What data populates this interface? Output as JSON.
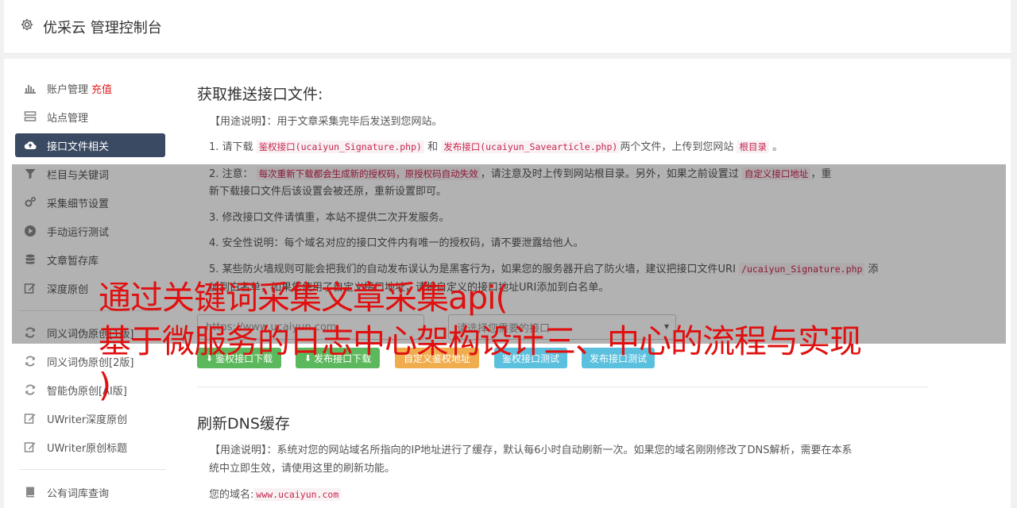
{
  "header": {
    "title": "优采云 管理控制台"
  },
  "sidebar": {
    "items": [
      {
        "label": "账户管理",
        "extra": "充值"
      },
      {
        "label": "站点管理"
      },
      {
        "label": "接口文件相关"
      },
      {
        "label": "栏目与关键词"
      },
      {
        "label": "采集细节设置"
      },
      {
        "label": "手动运行测试"
      },
      {
        "label": "文章暂存库"
      },
      {
        "label": "深度原创"
      },
      {
        "label": "同义词伪原创[1版]"
      },
      {
        "label": "同义词伪原创[2版]"
      },
      {
        "label": "智能伪原创[AI版]"
      },
      {
        "label": "UWriter深度原创"
      },
      {
        "label": "UWriter原创标题"
      },
      {
        "label": "公有词库查询"
      }
    ]
  },
  "section1": {
    "title": "获取推送接口文件:",
    "usage_label": "【用途说明】",
    "usage_text": "：用于文章采集完毕后发送到您网站。",
    "step1_a": "1. 请下载",
    "step1_code1": "鉴权接口(ucaiyun_Signature.php)",
    "step1_b": "和",
    "step1_code2": "发布接口(ucaiyun_Savearticle.php)",
    "step1_c": "两个文件，上传到您网站",
    "step1_code3": "根目录",
    "step1_d": "。",
    "step2_a": "2. 注意：",
    "step2_code1": "每次重新下载都会生成新的授权码，原授权码自动失效",
    "step2_b": "，请注意及时上传到网站根目录。另外，如果之前设置过",
    "step2_code2": "自定义接口地址",
    "step2_c": "，重",
    "step2_line2": "新下载接口文件后该设置会被还原，重新设置即可。",
    "step3": "3. 修改接口文件请慎重，本站不提供二次开发服务。",
    "step4": "4. 安全性说明：每个域名对应的接口文件内有唯一的授权码，请不要泄露给他人。",
    "step5_a": "5. 某些防火墙规则可能会把我们的自动发布误认为是黑客行为，如果您的服务器开启了防火墙，建议把接口文件URI",
    "step5_code": "/ucaiyun_Signature.php",
    "step5_b": "添",
    "step5_line2": "加到白名单，如果您使用了自定义接口地址，请将自定义的接口地址URI添加到白名单。",
    "domain_placeholder": "https://www.ucaiyun.com",
    "select_placeholder": "请选择您需要的接口",
    "buttons": {
      "download_auth": "鉴权接口下载",
      "download_publish": "发布接口下载",
      "custom_auth": "自定义鉴权地址",
      "test_auth": "鉴权接口测试",
      "test_publish": "发布接口测试"
    }
  },
  "section2": {
    "title": "刷新DNS缓存",
    "usage_label": "【用途说明】",
    "usage_text": "：系统对您的网站域名所指向的IP地址进行了缓存，默认每6小时自动刷新一次。如果您的域名刚刚修改了DNS解析，需要在本系",
    "usage_line2": "统中立即生效，请使用这里的刷新功能。",
    "domain_label": "您的域名:",
    "domain_value": "www.ucaiyun.com"
  },
  "banner": {
    "line1": "通过关键词采集文章采集api(",
    "line2": "基于微服务的日志中心架构设计三、中心的流程与实现",
    "line3": ")"
  },
  "colors": {
    "accent": "#3a4a62",
    "green": "#5cb85c",
    "orange": "#f0ad4e",
    "blue": "#5bc0de",
    "blue2": "#428bca",
    "headline": "#e01010"
  }
}
